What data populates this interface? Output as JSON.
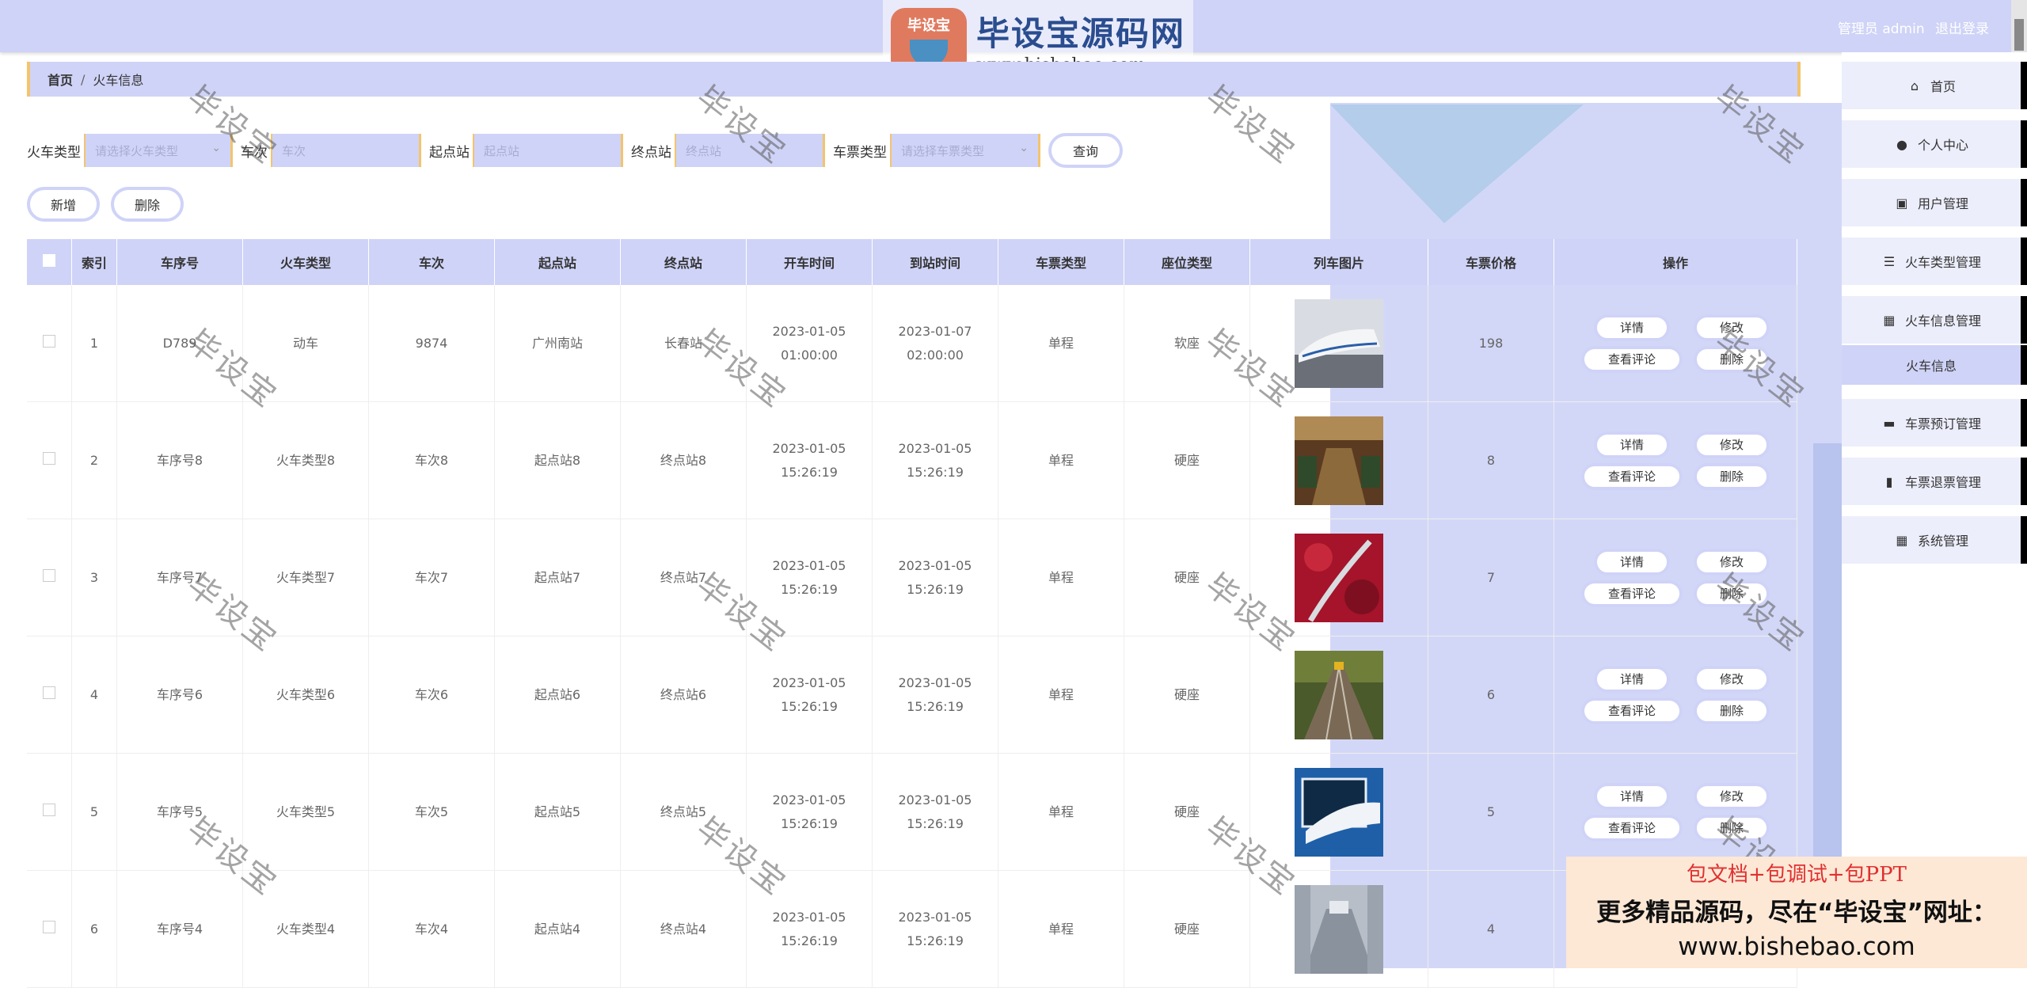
{
  "header": {
    "user_label": "管理员 admin",
    "logout_label": "退出登录"
  },
  "logo": {
    "badge_text": "毕设宝",
    "site_name": "毕设宝源码网",
    "site_url": "www.bishebao.com"
  },
  "breadcrumb": {
    "home": "首页",
    "separator": "/",
    "current": "火车信息"
  },
  "filters": {
    "train_type_label": "火车类型",
    "train_type_placeholder": "请选择火车类型",
    "train_no_label": "车次",
    "train_no_placeholder": "车次",
    "start_label": "起点站",
    "start_placeholder": "起点站",
    "end_label": "终点站",
    "end_placeholder": "终点站",
    "ticket_type_label": "车票类型",
    "ticket_type_placeholder": "请选择车票类型",
    "search_label": "查询"
  },
  "actions": {
    "add_label": "新增",
    "delete_label": "删除"
  },
  "table": {
    "columns": [
      "索引",
      "车序号",
      "火车类型",
      "车次",
      "起点站",
      "终点站",
      "开车时间",
      "到站时间",
      "车票类型",
      "座位类型",
      "列车图片",
      "车票价格",
      "操作"
    ],
    "op_labels": {
      "detail": "详情",
      "edit": "修改",
      "comments": "查看评论",
      "delete": "删除"
    },
    "rows": [
      {
        "idx": "1",
        "seq": "D789",
        "type": "动车",
        "no": "9874",
        "start": "广州南站",
        "end": "长春站",
        "depart": "2023-01-05 01:00:00",
        "arrive": "2023-01-07 02:00:00",
        "ticket": "单程",
        "seat": "软座",
        "price": "198"
      },
      {
        "idx": "2",
        "seq": "车序号8",
        "type": "火车类型8",
        "no": "车次8",
        "start": "起点站8",
        "end": "终点站8",
        "depart": "2023-01-05 15:26:19",
        "arrive": "2023-01-05 15:26:19",
        "ticket": "单程",
        "seat": "硬座",
        "price": "8"
      },
      {
        "idx": "3",
        "seq": "车序号7",
        "type": "火车类型7",
        "no": "车次7",
        "start": "起点站7",
        "end": "终点站7",
        "depart": "2023-01-05 15:26:19",
        "arrive": "2023-01-05 15:26:19",
        "ticket": "单程",
        "seat": "硬座",
        "price": "7"
      },
      {
        "idx": "4",
        "seq": "车序号6",
        "type": "火车类型6",
        "no": "车次6",
        "start": "起点站6",
        "end": "终点站6",
        "depart": "2023-01-05 15:26:19",
        "arrive": "2023-01-05 15:26:19",
        "ticket": "单程",
        "seat": "硬座",
        "price": "6"
      },
      {
        "idx": "5",
        "seq": "车序号5",
        "type": "火车类型5",
        "no": "车次5",
        "start": "起点站5",
        "end": "终点站5",
        "depart": "2023-01-05 15:26:19",
        "arrive": "2023-01-05 15:26:19",
        "ticket": "单程",
        "seat": "硬座",
        "price": "5"
      },
      {
        "idx": "6",
        "seq": "车序号4",
        "type": "火车类型4",
        "no": "车次4",
        "start": "起点站4",
        "end": "终点站4",
        "depart": "2023-01-05 15:26:19",
        "arrive": "2023-01-05 15:26:19",
        "ticket": "单程",
        "seat": "硬座",
        "price": "4"
      }
    ]
  },
  "sidebar": {
    "items": [
      {
        "label": "首页",
        "icon": "home-icon"
      },
      {
        "label": "个人中心",
        "icon": "user-icon"
      },
      {
        "label": "用户管理",
        "icon": "clipboard-icon"
      },
      {
        "label": "火车类型管理",
        "icon": "list-icon"
      },
      {
        "label": "火车信息管理",
        "icon": "grid-icon"
      },
      {
        "label": "火车信息",
        "icon": ""
      },
      {
        "label": "车票预订管理",
        "icon": "monitor-icon"
      },
      {
        "label": "车票退票管理",
        "icon": "bar-chart-icon"
      },
      {
        "label": "系统管理",
        "icon": "grid-icon"
      }
    ]
  },
  "watermark": {
    "text": "毕设宝"
  },
  "ad": {
    "line1": "包文档+包调试+包PPT",
    "line2": "更多精品源码，尽在“毕设宝”网址：",
    "line3": "www.bishebao.com"
  },
  "colors": {
    "primary_bg": "#cfd3f7",
    "accent_border": "#f3c46d",
    "sidebar_bg": "#eceefb"
  }
}
